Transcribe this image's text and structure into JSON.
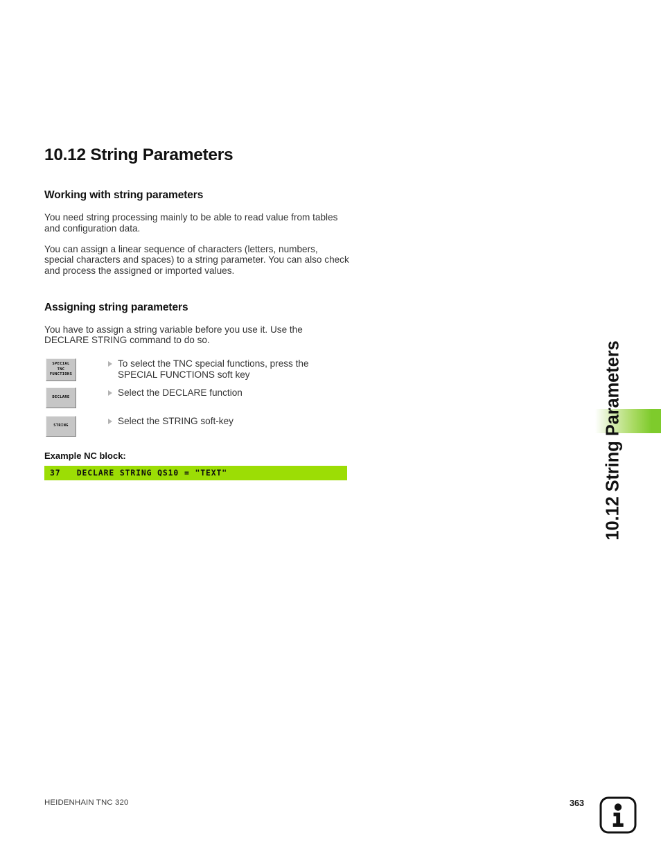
{
  "document": {
    "section_number": "10.12",
    "section_title": "10.12 String Parameters",
    "running_head": "10.12 String Parameters"
  },
  "content": {
    "subsections": [
      {
        "heading": "Working with string parameters",
        "paragraphs": [
          "You need string processing mainly to be able to read value from tables and configuration data.",
          "You can assign a linear sequence of characters (letters, numbers, special characters and spaces) to a string parameter. You can also check and process the assigned or imported values."
        ]
      },
      {
        "heading": "Assigning string parameters",
        "paragraphs": [
          "You have to assign a string variable before you use it. Use the DECLARE STRING command to do so."
        ]
      }
    ],
    "steps": [
      {
        "softkey_lines": [
          "SPECIAL",
          "TNC",
          "FUNCTIONS"
        ],
        "softkey_label": "SPECIAL TNC FUNCTIONS",
        "text": "To select the TNC special functions, press the SPECIAL FUNCTIONS soft key"
      },
      {
        "softkey_lines": [
          "DECLARE"
        ],
        "softkey_label": "DECLARE",
        "text": "Select the DECLARE function"
      },
      {
        "softkey_lines": [
          "STRING"
        ],
        "softkey_label": "STRING",
        "text": "Select the STRING soft-key"
      }
    ],
    "example": {
      "label": "Example NC block:",
      "code": "37   DECLARE STRING QS10 = \"TEXT\""
    }
  },
  "footer": {
    "product": "HEIDENHAIN TNC 320",
    "page_number": "363"
  },
  "colors": {
    "nc_block_green": "#9cdd05",
    "tab_green": "#7ecb2c",
    "softkey_gray": "#c6c6c6",
    "bullet_gray": "#b3b3b3"
  }
}
